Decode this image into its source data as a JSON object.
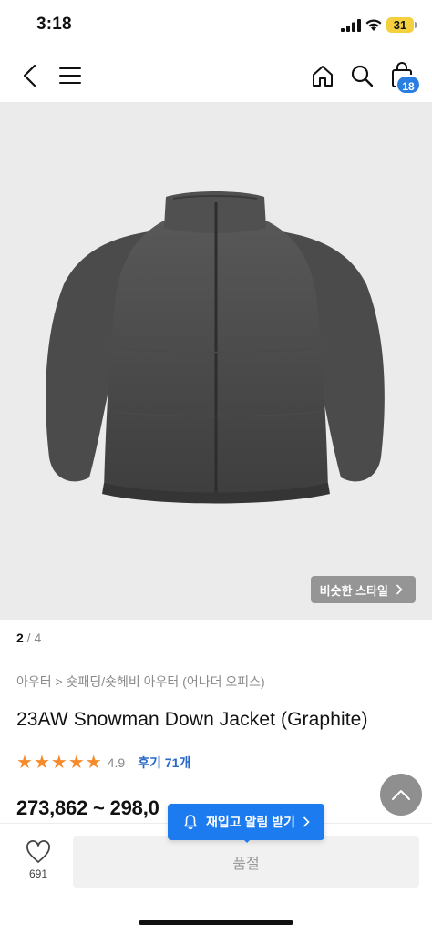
{
  "status_bar": {
    "time": "3:18",
    "battery": "31"
  },
  "nav": {
    "cart_count": "18"
  },
  "gallery": {
    "similar_style_label": "비슷한 스타일",
    "current_page": "2",
    "separator": " / ",
    "total_pages": "4"
  },
  "product": {
    "breadcrumb": "아우터 > 숏패딩/숏헤비 아우터 (어나더 오피스)",
    "title": "23AW Snowman Down Jacket (Graphite)",
    "rating": "4.9",
    "stars": 5,
    "review_label": "후기 71개",
    "price": "273,862 ~ 298,0"
  },
  "actions": {
    "restock_label": "재입고 알림 받기",
    "wish_count": "691",
    "soldout_label": "품절"
  },
  "colors": {
    "accent": "#1d7bf0",
    "star": "#f68b2c",
    "review_link": "#2a68c8",
    "badge": "#2a7de1"
  },
  "icons": [
    "back-icon",
    "menu-icon",
    "home-icon",
    "search-icon",
    "cart-icon",
    "chevron-right-icon",
    "bell-icon",
    "heart-icon",
    "chevron-up-icon",
    "star-icon"
  ]
}
